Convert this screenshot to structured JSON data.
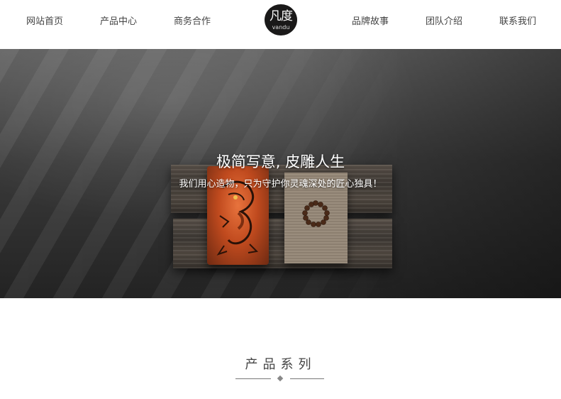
{
  "nav": {
    "left": [
      "网站首页",
      "产品中心",
      "商务合作"
    ],
    "right": [
      "品牌故事",
      "团队介绍",
      "联系我们"
    ],
    "logo": {
      "zh": "凡度",
      "en": "vandu"
    }
  },
  "hero": {
    "title": "极简写意, 皮雕人生",
    "subtitle": "我们用心造物，只为守护你灵魂深处的匠心独具！"
  },
  "section": {
    "title": "产品系列"
  },
  "colors": {
    "logo_bg": "#1a1919",
    "hero_bg": "#3a3a3a",
    "text": "#444444"
  }
}
